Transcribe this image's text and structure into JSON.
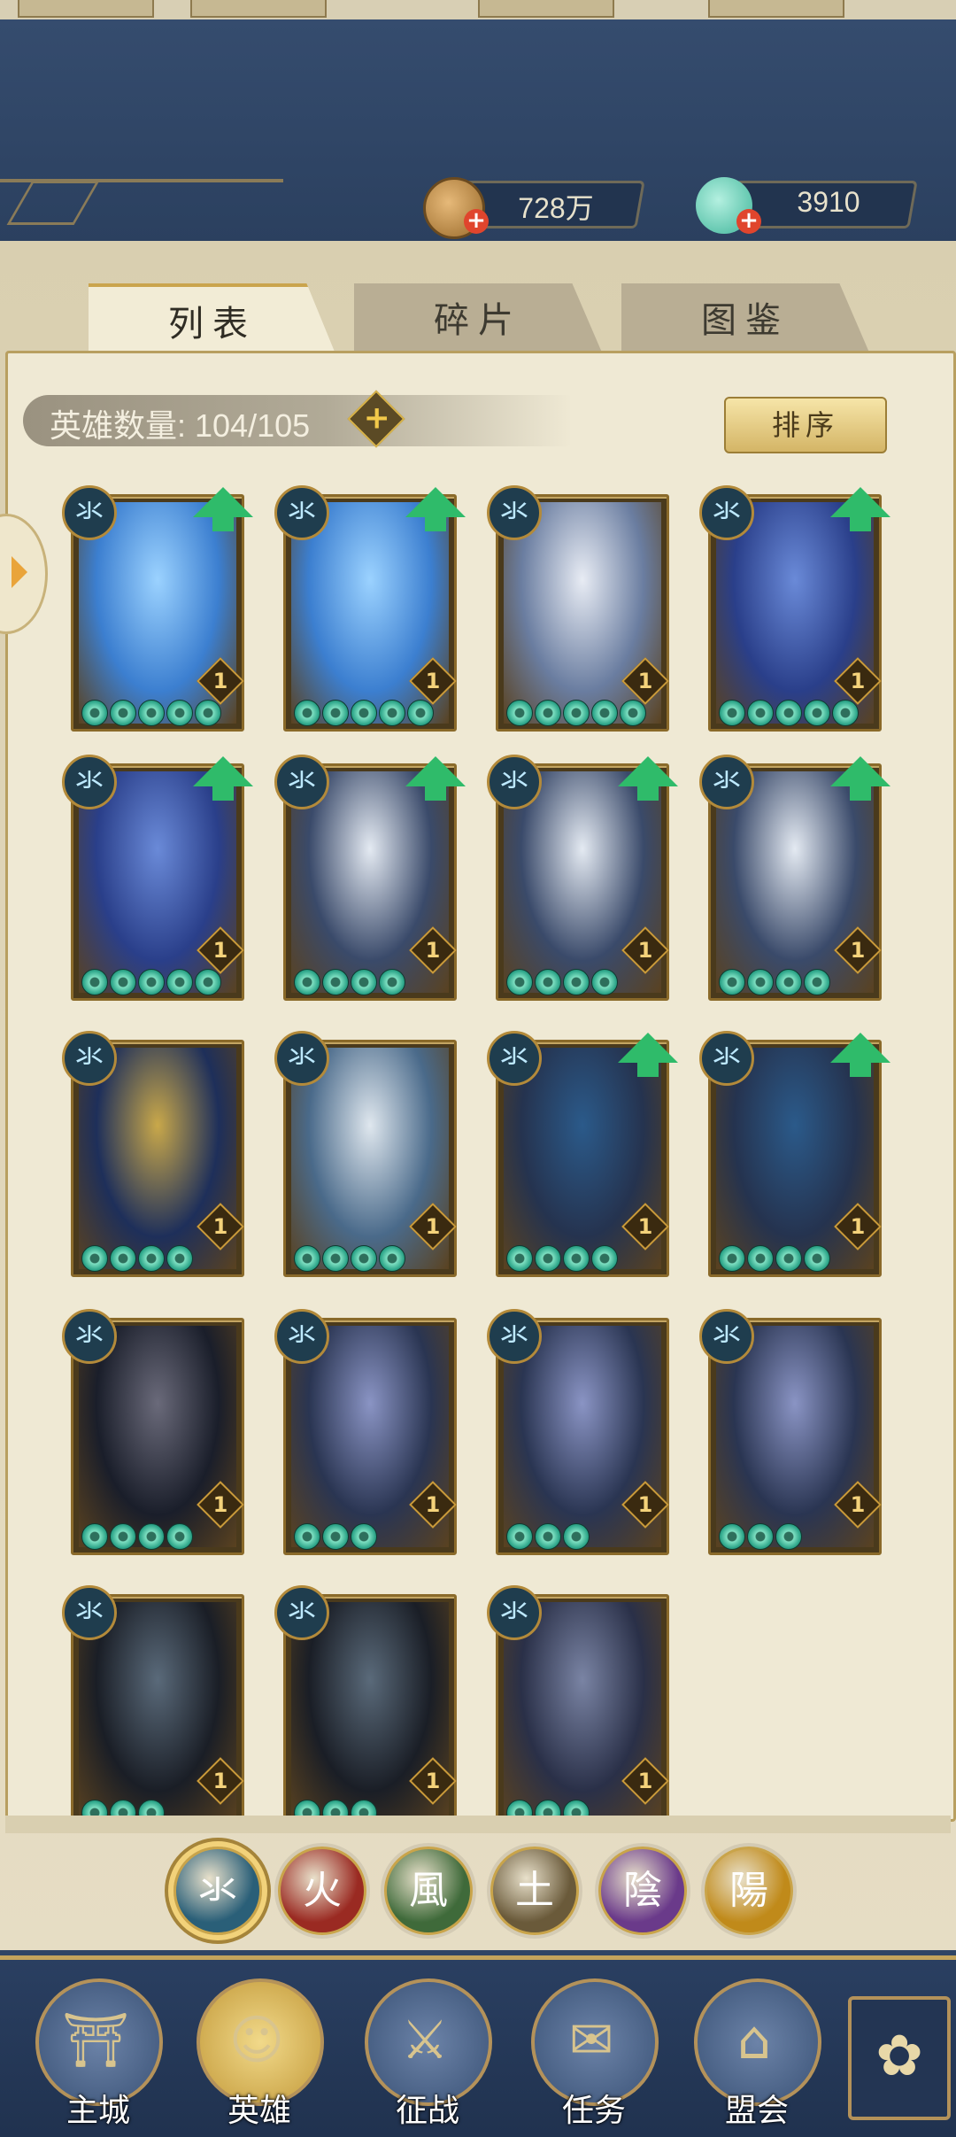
{
  "header": {
    "currencies": [
      {
        "name": "copper-coin",
        "value": "728万"
      },
      {
        "name": "jade",
        "value": "3910"
      }
    ]
  },
  "tabs": [
    {
      "label": "列表",
      "active": true
    },
    {
      "label": "碎片",
      "active": false
    },
    {
      "label": "图鉴",
      "active": false
    }
  ],
  "hero_count_label": "英雄数量: 104/105",
  "sort_button": "排序",
  "card_element_glyph": "氺",
  "cards": [
    {
      "stars": 5,
      "level": "1",
      "upgrade": true
    },
    {
      "stars": 5,
      "level": "1",
      "upgrade": true
    },
    {
      "stars": 5,
      "level": "1",
      "upgrade": false
    },
    {
      "stars": 5,
      "level": "1",
      "upgrade": true
    },
    {
      "stars": 5,
      "level": "1",
      "upgrade": true
    },
    {
      "stars": 4,
      "level": "1",
      "upgrade": true
    },
    {
      "stars": 4,
      "level": "1",
      "upgrade": true
    },
    {
      "stars": 4,
      "level": "1",
      "upgrade": true
    },
    {
      "stars": 4,
      "level": "1",
      "upgrade": false
    },
    {
      "stars": 4,
      "level": "1",
      "upgrade": false
    },
    {
      "stars": 4,
      "level": "1",
      "upgrade": true
    },
    {
      "stars": 4,
      "level": "1",
      "upgrade": true
    },
    {
      "stars": 4,
      "level": "1",
      "upgrade": false
    },
    {
      "stars": 3,
      "level": "1",
      "upgrade": false
    },
    {
      "stars": 3,
      "level": "1",
      "upgrade": false
    },
    {
      "stars": 3,
      "level": "1",
      "upgrade": false
    },
    {
      "stars": 3,
      "level": "1",
      "upgrade": false
    },
    {
      "stars": 3,
      "level": "1",
      "upgrade": false
    },
    {
      "stars": 3,
      "level": "1",
      "upgrade": false
    }
  ],
  "filters": [
    {
      "glyph": "氺",
      "color": "#2a5f78",
      "active": true
    },
    {
      "glyph": "火",
      "color": "#9a2a22",
      "active": false
    },
    {
      "glyph": "風",
      "color": "#3f6a3a",
      "active": false
    },
    {
      "glyph": "土",
      "color": "#6a5a3a",
      "active": false
    },
    {
      "glyph": "陰",
      "color": "#6a3a8a",
      "active": false
    },
    {
      "glyph": "陽",
      "color": "#c08a1a",
      "active": false
    }
  ],
  "nav": [
    {
      "label": "主城",
      "icon": "city-gate-icon",
      "active": false
    },
    {
      "label": "英雄",
      "icon": "hero-icon",
      "active": true
    },
    {
      "label": "征战",
      "icon": "campaign-icon",
      "active": false
    },
    {
      "label": "任务",
      "icon": "task-scroll-icon",
      "active": false
    },
    {
      "label": "盟会",
      "icon": "guild-icon",
      "active": false
    }
  ],
  "menu_icon": "menu-flower-icon"
}
